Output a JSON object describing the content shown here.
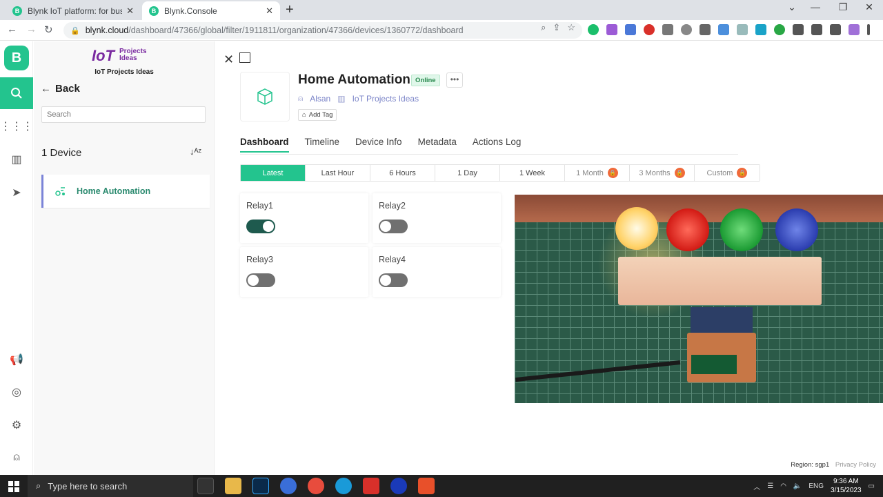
{
  "browser": {
    "tabs": [
      {
        "title": "Blynk IoT platform: for businesses",
        "favicon": "B"
      },
      {
        "title": "Blynk.Console",
        "favicon": "B"
      }
    ],
    "url_host": "blynk.cloud",
    "url_path": "/dashboard/47366/global/filter/1911811/organization/47366/devices/1360772/dashboard"
  },
  "org": {
    "logo_big": "IoT",
    "logo_small_1": "Projects",
    "logo_small_2": "Ideas",
    "name": "IoT Projects Ideas"
  },
  "panel": {
    "back_label": "Back",
    "search_placeholder": "Search",
    "device_count": "1 Device",
    "devices": [
      {
        "name": "Home Automation"
      }
    ]
  },
  "device": {
    "title": "Home Automation",
    "status": "Online",
    "owner": "Alsan",
    "organization": "IoT Projects Ideas",
    "add_tag": "Add Tag"
  },
  "tabs": [
    {
      "label": "Dashboard",
      "active": true
    },
    {
      "label": "Timeline"
    },
    {
      "label": "Device Info"
    },
    {
      "label": "Metadata"
    },
    {
      "label": "Actions Log"
    }
  ],
  "ranges": [
    {
      "label": "Latest",
      "active": true
    },
    {
      "label": "Last Hour"
    },
    {
      "label": "6 Hours"
    },
    {
      "label": "1 Day"
    },
    {
      "label": "1 Week"
    },
    {
      "label": "1 Month",
      "locked": true
    },
    {
      "label": "3 Months",
      "locked": true
    },
    {
      "label": "Custom",
      "locked": true
    }
  ],
  "widgets": [
    {
      "label": "Relay1",
      "on": true
    },
    {
      "label": "Relay2",
      "on": false
    },
    {
      "label": "Relay3",
      "on": false
    },
    {
      "label": "Relay4",
      "on": false
    }
  ],
  "footer": {
    "region": "Region: sgp1",
    "privacy": "Privacy Policy"
  },
  "taskbar": {
    "search_placeholder": "Type here to search",
    "language": "ENG",
    "time": "9:36 AM",
    "date": "3/15/2023"
  },
  "colors": {
    "accent": "#23c48e",
    "toggle_on": "#1e5a4e",
    "lock_badge": "#f06a3a"
  }
}
